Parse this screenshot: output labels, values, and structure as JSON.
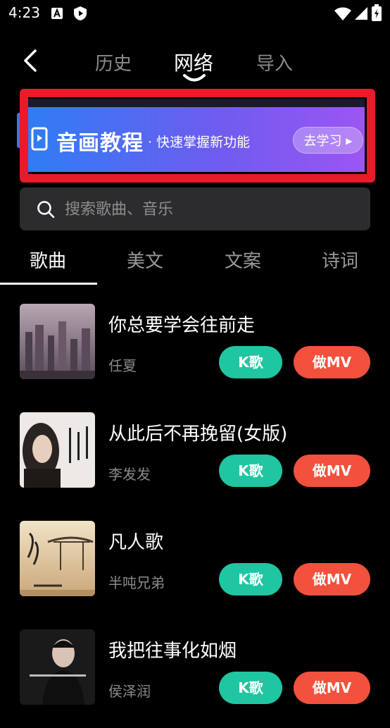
{
  "status": {
    "time": "4:23"
  },
  "header": {
    "tabs": [
      {
        "label": "历史",
        "active": false
      },
      {
        "label": "网络",
        "active": true
      },
      {
        "label": "导入",
        "active": false
      }
    ]
  },
  "banner": {
    "title": "音画教程",
    "subtitle": "· 快速掌握新功能",
    "button": "去学习"
  },
  "search": {
    "placeholder": "搜索歌曲、音乐"
  },
  "categories": [
    {
      "label": "歌曲",
      "active": true
    },
    {
      "label": "美文",
      "active": false
    },
    {
      "label": "文案",
      "active": false
    },
    {
      "label": "诗词",
      "active": false
    }
  ],
  "songs": [
    {
      "title": "你总要学会往前走",
      "artist": "任夏",
      "k_label": "K歌",
      "mv_label": "做MV"
    },
    {
      "title": "从此后不再挽留(女版)",
      "artist": "李发发",
      "k_label": "K歌",
      "mv_label": "做MV"
    },
    {
      "title": "凡人歌",
      "artist": "半吨兄弟",
      "k_label": "K歌",
      "mv_label": "做MV"
    },
    {
      "title": "我把往事化如烟",
      "artist": "侯泽润",
      "k_label": "K歌",
      "mv_label": "做MV"
    }
  ],
  "colors": {
    "k_button": "#1fc6a1",
    "mv_button": "#f2513d",
    "highlight_border": "#e91a2a"
  }
}
